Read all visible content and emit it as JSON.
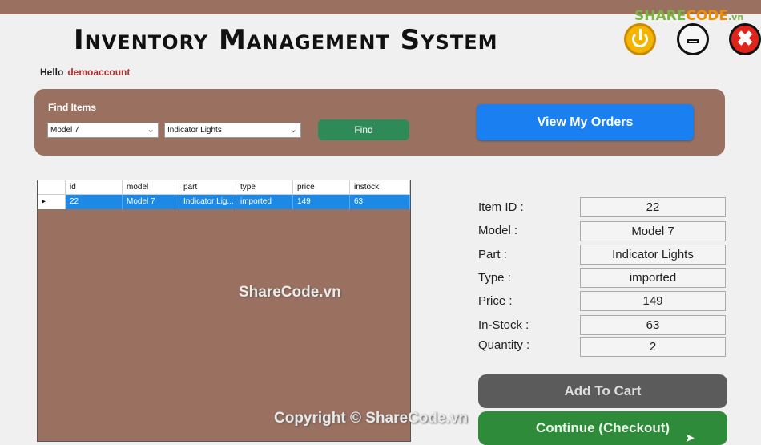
{
  "app": {
    "title": "Inventory Management System",
    "greeting": "Hello",
    "username": "demoaccount"
  },
  "window_controls": {
    "power_icon": "power-icon",
    "minimize_icon": "minimize-icon",
    "close_icon": "close-icon",
    "close_glyph": "✖"
  },
  "watermark": {
    "logo_part1": "SHARE",
    "logo_part2": "CODE",
    "logo_suffix": ".vn",
    "center_text": "ShareCode.vn",
    "bottom_text": "Copyright © ShareCode.vn"
  },
  "find": {
    "label": "Find Items",
    "model_value": "Model 7",
    "part_value": "Indicator Lights",
    "button_label": "Find"
  },
  "orders_button_label": "View My Orders",
  "grid": {
    "columns": [
      "id",
      "model",
      "part",
      "type",
      "price",
      "instock"
    ],
    "rows": [
      {
        "id": "22",
        "model": "Model 7",
        "part": "Indicator Lig...",
        "type": "imported",
        "price": "149",
        "instock": "63"
      }
    ],
    "row_marker": "▸"
  },
  "details": {
    "item_id_label": "Item ID :",
    "item_id": "22",
    "model_label": "Model :",
    "model": "Model 7",
    "part_label": "Part :",
    "part": "Indicator Lights",
    "type_label": "Type :",
    "type": "imported",
    "price_label": "Price :",
    "price": "149",
    "instock_label": "In-Stock :",
    "instock": "63",
    "quantity_label": "Quantity :",
    "quantity": "2"
  },
  "buttons": {
    "add_to_cart": "Add To Cart",
    "checkout": "Continue (Checkout)"
  },
  "colors": {
    "panel": "#9a7060",
    "accent_blue": "#1a7ff0",
    "find_green": "#2e8b57",
    "checkout_green": "#2e8b3a",
    "cart_gray": "#5b5b5b",
    "username_red": "#b03030"
  }
}
